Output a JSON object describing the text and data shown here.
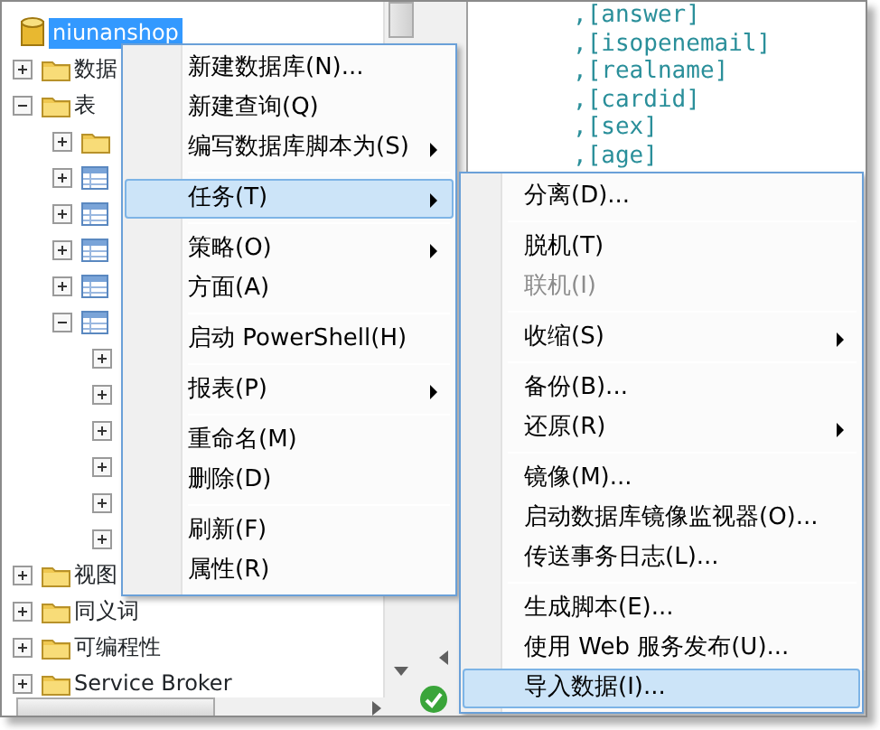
{
  "tree": [
    {
      "kind": "database",
      "label": "niunanshop",
      "selected": true,
      "children": [
        {
          "kind": "folder",
          "label": "数据",
          "expanded": false
        },
        {
          "kind": "folder",
          "label": "表",
          "expanded": true,
          "children": [
            {
              "kind": "folder",
              "expanded": false
            },
            {
              "kind": "table",
              "expanded": false
            },
            {
              "kind": "table",
              "expanded": false
            },
            {
              "kind": "table",
              "expanded": false
            },
            {
              "kind": "table",
              "expanded": false
            },
            {
              "kind": "table",
              "expanded": true,
              "children": [
                {
                  "expanded": false
                },
                {
                  "expanded": false
                },
                {
                  "expanded": false
                },
                {
                  "expanded": false
                },
                {
                  "expanded": false
                },
                {
                  "expanded": false
                }
              ]
            }
          ]
        },
        {
          "kind": "folder",
          "label": "视图",
          "expanded": false
        },
        {
          "kind": "folder",
          "label": "同义词",
          "expanded": false
        },
        {
          "kind": "folder",
          "label": "可编程性",
          "expanded": false
        },
        {
          "kind": "folder",
          "label": "Service Broker",
          "expanded": false
        }
      ]
    }
  ],
  "editor": {
    "lines": [
      ",[answer]",
      ",[isopenemail]",
      ",[realname]",
      ",[cardid]",
      ",[sex]",
      ",[age]"
    ]
  },
  "context_menu": [
    {
      "kind": "item",
      "label": "新建数据库(N)...",
      "submenu": false,
      "selected": false,
      "disabled": false
    },
    {
      "kind": "item",
      "label": "新建查询(Q)",
      "submenu": false,
      "selected": false,
      "disabled": false
    },
    {
      "kind": "item",
      "label": "编写数据库脚本为(S)",
      "submenu": true,
      "selected": false,
      "disabled": false
    },
    {
      "kind": "separator"
    },
    {
      "kind": "item",
      "label": "任务(T)",
      "submenu": true,
      "selected": true,
      "disabled": false
    },
    {
      "kind": "separator"
    },
    {
      "kind": "item",
      "label": "策略(O)",
      "submenu": true,
      "selected": false,
      "disabled": false
    },
    {
      "kind": "item",
      "label": "方面(A)",
      "submenu": false,
      "selected": false,
      "disabled": false
    },
    {
      "kind": "separator"
    },
    {
      "kind": "item",
      "label": "启动 PowerShell(H)",
      "submenu": false,
      "selected": false,
      "disabled": false
    },
    {
      "kind": "separator"
    },
    {
      "kind": "item",
      "label": "报表(P)",
      "submenu": true,
      "selected": false,
      "disabled": false
    },
    {
      "kind": "separator"
    },
    {
      "kind": "item",
      "label": "重命名(M)",
      "submenu": false,
      "selected": false,
      "disabled": false
    },
    {
      "kind": "item",
      "label": "删除(D)",
      "submenu": false,
      "selected": false,
      "disabled": false
    },
    {
      "kind": "separator"
    },
    {
      "kind": "item",
      "label": "刷新(F)",
      "submenu": false,
      "selected": false,
      "disabled": false
    },
    {
      "kind": "item",
      "label": "属性(R)",
      "submenu": false,
      "selected": false,
      "disabled": false
    }
  ],
  "tasks_submenu": [
    {
      "kind": "item",
      "label": "分离(D)...",
      "submenu": false,
      "selected": false,
      "disabled": false
    },
    {
      "kind": "separator"
    },
    {
      "kind": "item",
      "label": "脱机(T)",
      "submenu": false,
      "selected": false,
      "disabled": false
    },
    {
      "kind": "item",
      "label": "联机(I)",
      "submenu": false,
      "selected": false,
      "disabled": true
    },
    {
      "kind": "separator"
    },
    {
      "kind": "item",
      "label": "收缩(S)",
      "submenu": true,
      "selected": false,
      "disabled": false
    },
    {
      "kind": "separator"
    },
    {
      "kind": "item",
      "label": "备份(B)...",
      "submenu": false,
      "selected": false,
      "disabled": false
    },
    {
      "kind": "item",
      "label": "还原(R)",
      "submenu": true,
      "selected": false,
      "disabled": false
    },
    {
      "kind": "separator"
    },
    {
      "kind": "item",
      "label": "镜像(M)...",
      "submenu": false,
      "selected": false,
      "disabled": false
    },
    {
      "kind": "item",
      "label": "启动数据库镜像监视器(O)...",
      "submenu": false,
      "selected": false,
      "disabled": false
    },
    {
      "kind": "item",
      "label": "传送事务日志(L)...",
      "submenu": false,
      "selected": false,
      "disabled": false
    },
    {
      "kind": "separator"
    },
    {
      "kind": "item",
      "label": "生成脚本(E)...",
      "submenu": false,
      "selected": false,
      "disabled": false
    },
    {
      "kind": "item",
      "label": "使用 Web 服务发布(U)...",
      "submenu": false,
      "selected": false,
      "disabled": false
    },
    {
      "kind": "item",
      "label": "导入数据(I)...",
      "submenu": false,
      "selected": true,
      "disabled": false
    }
  ]
}
